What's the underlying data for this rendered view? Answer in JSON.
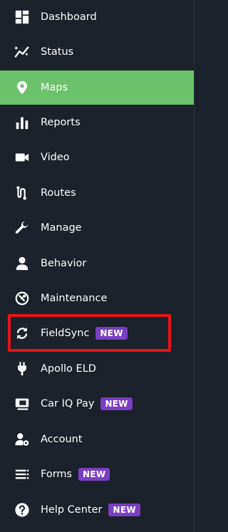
{
  "sidebar": {
    "items": [
      {
        "label": "Dashboard",
        "icon": "dashboard-icon",
        "active": false
      },
      {
        "label": "Status",
        "icon": "status-icon",
        "active": false
      },
      {
        "label": "Maps",
        "icon": "map-pin-icon",
        "active": true
      },
      {
        "label": "Reports",
        "icon": "bar-chart-icon",
        "active": false
      },
      {
        "label": "Video",
        "icon": "video-camera-icon",
        "active": false
      },
      {
        "label": "Routes",
        "icon": "routes-icon",
        "active": false
      },
      {
        "label": "Manage",
        "icon": "wrench-icon",
        "active": false
      },
      {
        "label": "Behavior",
        "icon": "person-icon",
        "active": false
      },
      {
        "label": "Maintenance",
        "icon": "maintenance-icon",
        "active": false
      },
      {
        "label": "FieldSync",
        "icon": "sync-icon",
        "active": false,
        "badge": "NEW",
        "highlighted": true
      },
      {
        "label": "Apollo ELD",
        "icon": "plug-icon",
        "active": false
      },
      {
        "label": "Car IQ Pay",
        "icon": "pay-icon",
        "active": false,
        "badge": "NEW"
      },
      {
        "label": "Account",
        "icon": "account-gear-icon",
        "active": false
      },
      {
        "label": "Forms",
        "icon": "forms-list-icon",
        "active": false,
        "badge": "NEW"
      },
      {
        "label": "Help Center",
        "icon": "help-icon",
        "active": false,
        "badge": "NEW"
      }
    ]
  },
  "colors": {
    "background": "#1b222b",
    "active": "#6cc26a",
    "badge": "#7a3fc2",
    "highlight": "#e3141a"
  }
}
